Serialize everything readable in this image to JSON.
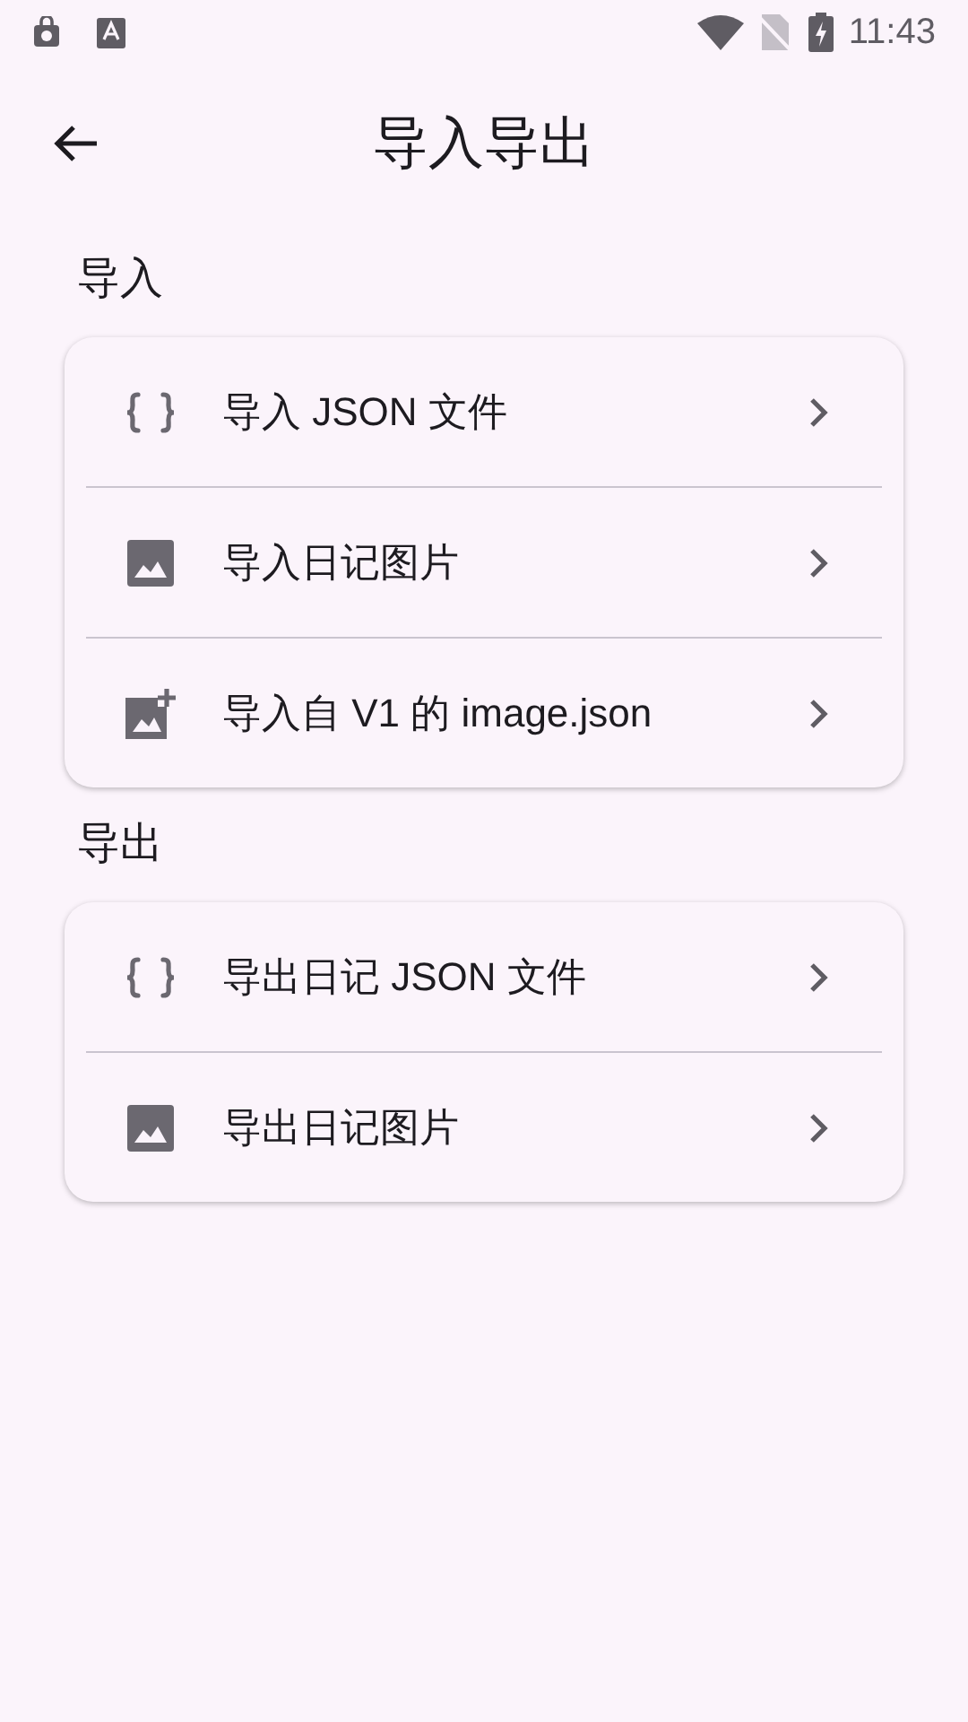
{
  "status_bar": {
    "time": "11:43"
  },
  "app_bar": {
    "title": "导入导出"
  },
  "sections": [
    {
      "title": "导入",
      "items": [
        {
          "kind": "json",
          "label": "导入 JSON 文件"
        },
        {
          "kind": "image",
          "label": "导入日记图片"
        },
        {
          "kind": "image-add",
          "label": "导入自 V1 的 image.json"
        }
      ]
    },
    {
      "title": "导出",
      "items": [
        {
          "kind": "json",
          "label": "导出日记 JSON 文件"
        },
        {
          "kind": "image",
          "label": "导出日记图片"
        }
      ]
    }
  ]
}
